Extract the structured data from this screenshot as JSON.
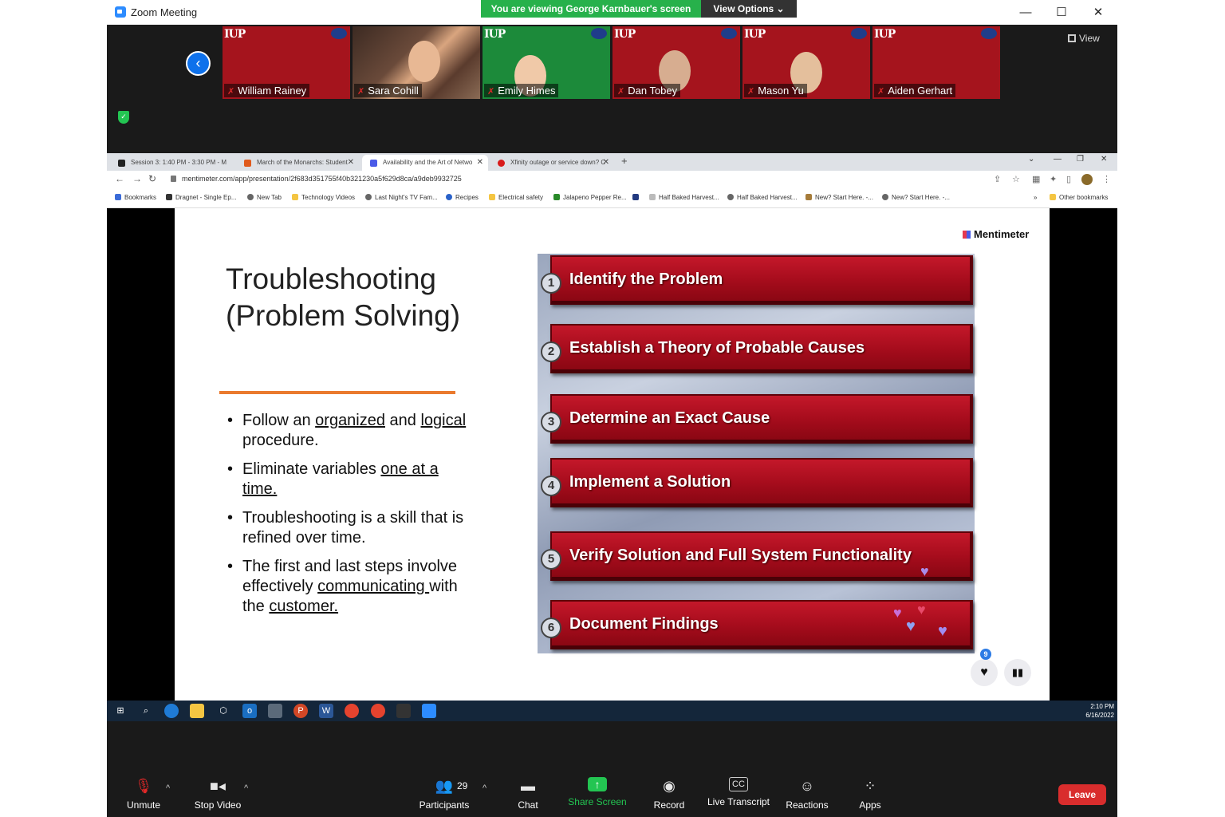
{
  "window": {
    "title": "Zoom Meeting",
    "banner": "You are viewing George Karnbauer's screen",
    "view_options": "View Options ⌄",
    "minimize": "—",
    "maximize": "☐",
    "close": "✕"
  },
  "strip": {
    "view_label": "View",
    "participants": [
      {
        "name": "William Rainey"
      },
      {
        "name": "Sara Cohill"
      },
      {
        "name": "Emily Himes"
      },
      {
        "name": "Dan Tobey"
      },
      {
        "name": "Mason Yu"
      },
      {
        "name": "Aiden Gerhart"
      }
    ],
    "tile_logo": "IUP"
  },
  "browser": {
    "tabs": [
      {
        "label": "Session 3: 1:40 PM - 3:30 PM - M"
      },
      {
        "label": "March of the Monarchs: Student"
      },
      {
        "label": "Availability and the Art of Netwo"
      },
      {
        "label": "Xfinity outage or service down? C"
      }
    ],
    "url": "mentimeter.com/app/presentation/2f683d351755f40b321230a5f629d8ca/a9deb9932725",
    "bookmarks": [
      "Bookmarks",
      "Dragnet - Single Ep...",
      "New Tab",
      "Technology Videos",
      "Last Night's TV Fam...",
      "Recipes",
      "Electrical safety",
      "Jalapeno Pepper Re...",
      "Half Baked Harvest...",
      "Half Baked Harvest...",
      "New? Start Here. -...",
      "New? Start Here. -...",
      "Other bookmarks"
    ]
  },
  "slide": {
    "brand": "Mentimeter",
    "title": "Troubleshooting (Problem Solving)",
    "bullets": [
      {
        "pre": "Follow an ",
        "u1": "organized",
        "mid": " and ",
        "u2": "logical ",
        "post": "procedure."
      },
      {
        "pre": "Eliminate variables ",
        "u1": "one at a time.",
        "mid": "",
        "u2": "",
        "post": ""
      },
      {
        "pre": "Troubleshooting is a skill that is refined over time.",
        "u1": "",
        "mid": "",
        "u2": "",
        "post": ""
      },
      {
        "pre": "The first and last steps involve effectively ",
        "u1": "communicating ",
        "mid": "with the ",
        "u2": "customer.",
        "post": ""
      }
    ],
    "steps": [
      {
        "num": "1",
        "label": "Identify the Problem"
      },
      {
        "num": "2",
        "label": "Establish a Theory of Probable Causes"
      },
      {
        "num": "3",
        "label": "Determine an Exact Cause"
      },
      {
        "num": "4",
        "label": "Implement a Solution"
      },
      {
        "num": "5",
        "label": "Verify Solution and Full System Functionality"
      },
      {
        "num": "6",
        "label": "Document Findings"
      }
    ],
    "reaction_count": "9"
  },
  "taskbar": {
    "time": "2:10 PM",
    "date": "6/16/2022"
  },
  "controls": {
    "unmute": "Unmute",
    "stop_video": "Stop Video",
    "participants": "Participants",
    "participant_count": "29",
    "chat": "Chat",
    "share_screen": "Share Screen",
    "record": "Record",
    "live_transcript": "Live Transcript",
    "reactions": "Reactions",
    "apps": "Apps",
    "leave": "Leave"
  },
  "colors": {
    "banner": "#27b14b",
    "step_red": "#a50c1c",
    "accent_orange": "#ea7a2e",
    "leave_red": "#d92d2d"
  }
}
